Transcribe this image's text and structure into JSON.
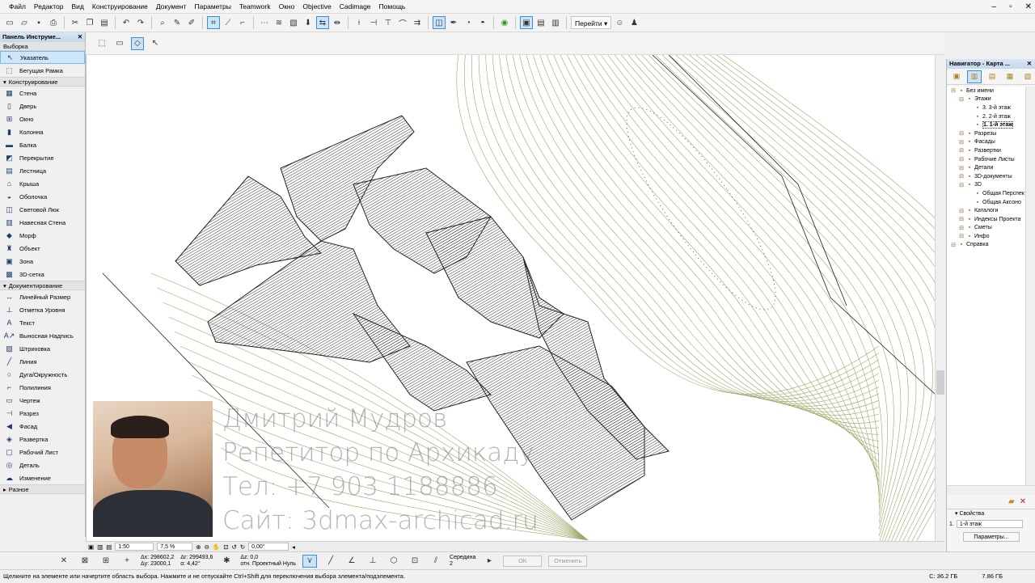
{
  "menu": [
    "Файл",
    "Редактор",
    "Вид",
    "Конструирование",
    "Документ",
    "Параметры",
    "Teamwork",
    "Окно",
    "Objective",
    "Cadimage",
    "Помощь"
  ],
  "toolbar": {
    "goto_label": "Перейти"
  },
  "toolbox": {
    "title": "Панель Инструме...",
    "selection_header": "Выборка",
    "selection_tools": [
      {
        "label": "Указатель",
        "icon": "arrow-cursor-icon",
        "glyph": "↖"
      },
      {
        "label": "Бегущая Рамка",
        "icon": "marquee-icon",
        "glyph": "⬚"
      }
    ],
    "design_header": "Конструирование",
    "design_tools": [
      {
        "label": "Стена",
        "icon": "wall-icon",
        "glyph": "▦"
      },
      {
        "label": "Дверь",
        "icon": "door-icon",
        "glyph": "▯"
      },
      {
        "label": "Окно",
        "icon": "window-icon",
        "glyph": "⊞"
      },
      {
        "label": "Колонна",
        "icon": "column-icon",
        "glyph": "▮"
      },
      {
        "label": "Балка",
        "icon": "beam-icon",
        "glyph": "▬"
      },
      {
        "label": "Перекрытие",
        "icon": "slab-icon",
        "glyph": "◩"
      },
      {
        "label": "Лестница",
        "icon": "stair-icon",
        "glyph": "▤"
      },
      {
        "label": "Крыша",
        "icon": "roof-icon",
        "glyph": "⌂"
      },
      {
        "label": "Оболочка",
        "icon": "shell-icon",
        "glyph": "◒"
      },
      {
        "label": "Световой Люк",
        "icon": "skylight-icon",
        "glyph": "◫"
      },
      {
        "label": "Навесная Стена",
        "icon": "curtain-wall-icon",
        "glyph": "▥"
      },
      {
        "label": "Морф",
        "icon": "morph-icon",
        "glyph": "◆"
      },
      {
        "label": "Объект",
        "icon": "object-icon",
        "glyph": "♜"
      },
      {
        "label": "Зона",
        "icon": "zone-icon",
        "glyph": "▣"
      },
      {
        "label": "3D-сетка",
        "icon": "mesh-icon",
        "glyph": "▩"
      }
    ],
    "doc_header": "Документирование",
    "doc_tools": [
      {
        "label": "Линейный Размер",
        "icon": "dimension-icon",
        "glyph": "↔"
      },
      {
        "label": "Отметка Уровня",
        "icon": "level-icon",
        "glyph": "⊥"
      },
      {
        "label": "Текст",
        "icon": "text-icon",
        "glyph": "A"
      },
      {
        "label": "Выносная Надпись",
        "icon": "label-icon",
        "glyph": "A↗"
      },
      {
        "label": "Штриховка",
        "icon": "fill-icon",
        "glyph": "▨"
      },
      {
        "label": "Линия",
        "icon": "line-icon",
        "glyph": "╱"
      },
      {
        "label": "Дуга/Окружность",
        "icon": "arc-icon",
        "glyph": "○"
      },
      {
        "label": "Полилиния",
        "icon": "polyline-icon",
        "glyph": "⌐"
      },
      {
        "label": "Чертеж",
        "icon": "drawing-icon",
        "glyph": "▭"
      },
      {
        "label": "Разрез",
        "icon": "section-icon",
        "glyph": "⊣"
      },
      {
        "label": "Фасад",
        "icon": "elevation-icon",
        "glyph": "◀"
      },
      {
        "label": "Развертка",
        "icon": "interior-elevation-icon",
        "glyph": "◈"
      },
      {
        "label": "Рабочий Лист",
        "icon": "worksheet-icon",
        "glyph": "▢"
      },
      {
        "label": "Деталь",
        "icon": "detail-icon",
        "glyph": "◎"
      },
      {
        "label": "Изменение",
        "icon": "change-icon",
        "glyph": "☁"
      }
    ],
    "more_header": "Разное"
  },
  "watermark": {
    "name": "Дмитрий Мудров",
    "role": "Репетитор по Архикаду",
    "phone": "Тел: +7 903 1188886",
    "site": "Сайт: 3dmax-archicad.ru"
  },
  "bottombar": {
    "scale": "1:50",
    "zoom": "7,5 %",
    "angle": "0,00°"
  },
  "coords": {
    "dx": "Δx: 298602,2",
    "dy": "Δy: 23000,1",
    "rx": "Δr: 299493,6",
    "ra": "α: 4,42°",
    "dz": "Δz: 0,0",
    "ref": "отн. Проектный Нуль",
    "snap": "Середина",
    "snap_num": "2",
    "ok": "OK",
    "cancel": "Отменить"
  },
  "status": {
    "hint": "Щелкните на элементе или начертите область выбора. Нажмите и не отпускайте Ctrl+Shift для переключения выбора элемента/подэлемента.",
    "disk_c": "C: 36.2 ГБ",
    "memory": "7.86 ГБ"
  },
  "navigator": {
    "title": "Навигатор - Карта ...",
    "tree": [
      {
        "label": "Без имени",
        "indent": 0,
        "icon": "project-icon"
      },
      {
        "label": "Этажи",
        "indent": 1,
        "icon": "stories-icon"
      },
      {
        "label": "3. 3-й этаж",
        "indent": 2,
        "icon": "story-icon"
      },
      {
        "label": "2. 2-й этаж",
        "indent": 2,
        "icon": "story-icon"
      },
      {
        "label": "1. 1-й этаж",
        "indent": 2,
        "icon": "story-icon",
        "bold": true
      },
      {
        "label": "Разрезы",
        "indent": 1,
        "icon": "sections-icon"
      },
      {
        "label": "Фасады",
        "indent": 1,
        "icon": "elevations-icon"
      },
      {
        "label": "Развертки",
        "indent": 1,
        "icon": "interior-elevations-icon"
      },
      {
        "label": "Рабочие Листы",
        "indent": 1,
        "icon": "worksheets-icon"
      },
      {
        "label": "Детали",
        "indent": 1,
        "icon": "details-icon"
      },
      {
        "label": "3D-документы",
        "indent": 1,
        "icon": "3d-documents-icon"
      },
      {
        "label": "3D",
        "indent": 1,
        "icon": "3d-icon"
      },
      {
        "label": "Общая Перспек",
        "indent": 2,
        "icon": "perspective-icon"
      },
      {
        "label": "Общая Аксоно",
        "indent": 2,
        "icon": "axonometry-icon"
      },
      {
        "label": "Каталоги",
        "indent": 1,
        "icon": "schedules-icon"
      },
      {
        "label": "Индексы Проекта",
        "indent": 1,
        "icon": "project-indexes-icon"
      },
      {
        "label": "Сметы",
        "indent": 1,
        "icon": "lists-icon"
      },
      {
        "label": "Инфо",
        "indent": 1,
        "icon": "info-icon"
      },
      {
        "label": "Справка",
        "indent": 0,
        "icon": "help-icon"
      }
    ],
    "props_header": "Свойства",
    "props_number": "1.",
    "props_value": "1-й этаж",
    "props_button": "Параметры..."
  }
}
